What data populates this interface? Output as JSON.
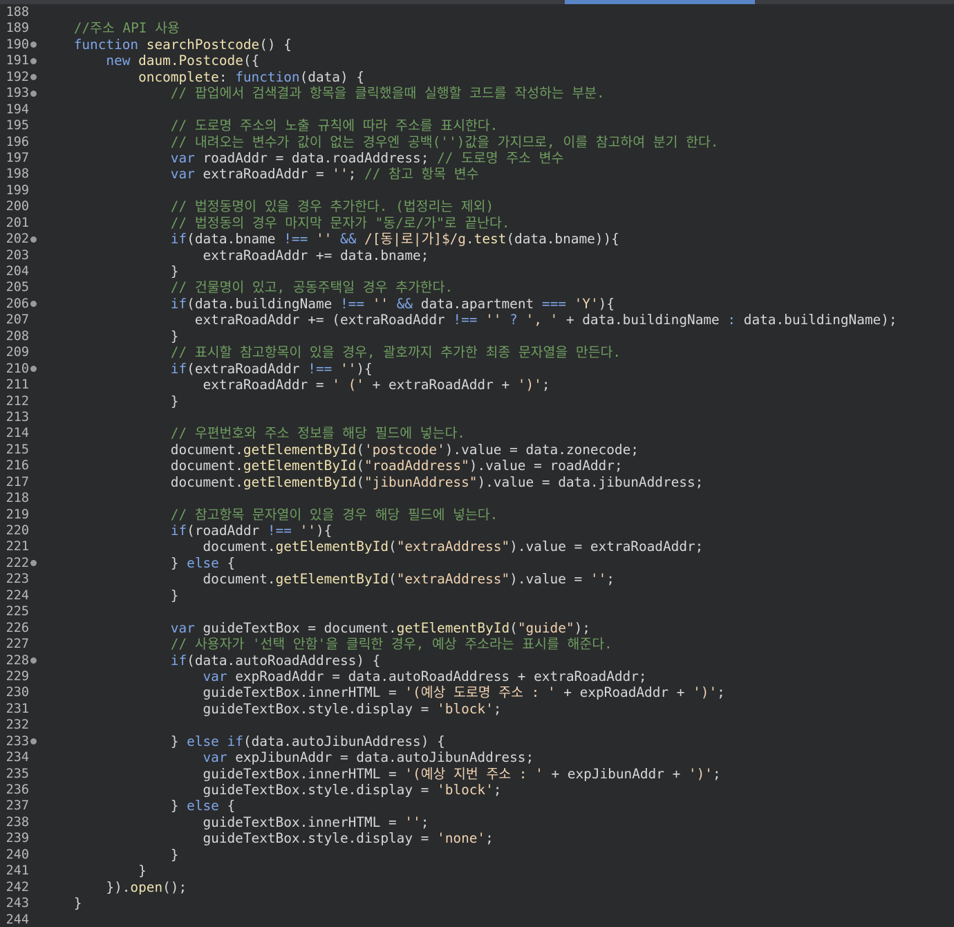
{
  "editor": {
    "language": "javascript",
    "first_line": 188,
    "colors": {
      "background": "#2a2b2d",
      "line_number": "#b9b9b9",
      "keyword": "#7fa6e8",
      "function_name": "#f0e3b0",
      "string": "#f0d3b0",
      "comment": "#6f9e60",
      "text": "#d8d8d8",
      "fold_marker": "#9a9a9a",
      "tab_indicator": "#5a86c8"
    },
    "lines": [
      {
        "n": "188",
        "fold": false,
        "tokens": []
      },
      {
        "n": "189",
        "fold": false,
        "tokens": [
          {
            "t": "    "
          },
          {
            "c": "com",
            "t": "//주소 API 사용"
          }
        ]
      },
      {
        "n": "190",
        "fold": true,
        "tokens": [
          {
            "t": "    "
          },
          {
            "c": "kw",
            "t": "function"
          },
          {
            "t": " "
          },
          {
            "c": "fn",
            "t": "searchPostcode"
          },
          {
            "t": "() {"
          }
        ]
      },
      {
        "n": "191",
        "fold": true,
        "tokens": [
          {
            "t": "        "
          },
          {
            "c": "kw",
            "t": "new"
          },
          {
            "t": " "
          },
          {
            "c": "fn",
            "t": "daum.Postcode"
          },
          {
            "t": "({"
          }
        ]
      },
      {
        "n": "192",
        "fold": true,
        "tokens": [
          {
            "t": "            "
          },
          {
            "c": "fn",
            "t": "oncomplete"
          },
          {
            "t": ": "
          },
          {
            "c": "kw",
            "t": "function"
          },
          {
            "t": "(data) {"
          }
        ]
      },
      {
        "n": "193",
        "fold": true,
        "tokens": [
          {
            "t": "                "
          },
          {
            "c": "com",
            "t": "// 팝업에서 검색결과 항목을 클릭했을때 실행할 코드를 작성하는 부분."
          }
        ]
      },
      {
        "n": "194",
        "fold": false,
        "tokens": []
      },
      {
        "n": "195",
        "fold": false,
        "tokens": [
          {
            "t": "                "
          },
          {
            "c": "com",
            "t": "// 도로명 주소의 노출 규칙에 따라 주소를 표시한다."
          }
        ]
      },
      {
        "n": "196",
        "fold": false,
        "tokens": [
          {
            "t": "                "
          },
          {
            "c": "com",
            "t": "// 내려오는 변수가 값이 없는 경우엔 공백('')값을 가지므로, 이를 참고하여 분기 한다."
          }
        ]
      },
      {
        "n": "197",
        "fold": false,
        "tokens": [
          {
            "t": "                "
          },
          {
            "c": "kw",
            "t": "var"
          },
          {
            "t": " roadAddr = data.roadAddress; "
          },
          {
            "c": "com",
            "t": "// 도로명 주소 변수"
          }
        ]
      },
      {
        "n": "198",
        "fold": false,
        "tokens": [
          {
            "t": "                "
          },
          {
            "c": "kw",
            "t": "var"
          },
          {
            "t": " extraRoadAddr = "
          },
          {
            "c": "str",
            "t": "''"
          },
          {
            "t": "; "
          },
          {
            "c": "com",
            "t": "// 참고 항목 변수"
          }
        ]
      },
      {
        "n": "199",
        "fold": false,
        "tokens": []
      },
      {
        "n": "200",
        "fold": false,
        "tokens": [
          {
            "t": "                "
          },
          {
            "c": "com",
            "t": "// 법정동명이 있을 경우 추가한다. (법정리는 제외)"
          }
        ]
      },
      {
        "n": "201",
        "fold": false,
        "tokens": [
          {
            "t": "                "
          },
          {
            "c": "com",
            "t": "// 법정동의 경우 마지막 문자가 \"동/로/가\"로 끝난다."
          }
        ]
      },
      {
        "n": "202",
        "fold": true,
        "tokens": [
          {
            "t": "                "
          },
          {
            "c": "kw",
            "t": "if"
          },
          {
            "t": "(data.bname "
          },
          {
            "c": "kw",
            "t": "!=="
          },
          {
            "t": " "
          },
          {
            "c": "str",
            "t": "''"
          },
          {
            "t": " "
          },
          {
            "c": "kw",
            "t": "&&"
          },
          {
            "t": " "
          },
          {
            "c": "str",
            "t": "/[동|로|가]$/g"
          },
          {
            "t": "."
          },
          {
            "c": "fn",
            "t": "test"
          },
          {
            "t": "(data.bname)){"
          }
        ]
      },
      {
        "n": "203",
        "fold": false,
        "tokens": [
          {
            "t": "                    extraRoadAddr += data.bname;"
          }
        ]
      },
      {
        "n": "204",
        "fold": false,
        "tokens": [
          {
            "t": "                }"
          }
        ]
      },
      {
        "n": "205",
        "fold": false,
        "tokens": [
          {
            "t": "                "
          },
          {
            "c": "com",
            "t": "// 건물명이 있고, 공동주택일 경우 추가한다."
          }
        ]
      },
      {
        "n": "206",
        "fold": true,
        "tokens": [
          {
            "t": "                "
          },
          {
            "c": "kw",
            "t": "if"
          },
          {
            "t": "(data.buildingName "
          },
          {
            "c": "kw",
            "t": "!=="
          },
          {
            "t": " "
          },
          {
            "c": "str",
            "t": "''"
          },
          {
            "t": " "
          },
          {
            "c": "kw",
            "t": "&&"
          },
          {
            "t": " data.apartment "
          },
          {
            "c": "kw",
            "t": "==="
          },
          {
            "t": " "
          },
          {
            "c": "str",
            "t": "'Y'"
          },
          {
            "t": "){"
          }
        ]
      },
      {
        "n": "207",
        "fold": false,
        "tokens": [
          {
            "t": "                   extraRoadAddr += (extraRoadAddr "
          },
          {
            "c": "kw",
            "t": "!=="
          },
          {
            "t": " "
          },
          {
            "c": "str",
            "t": "''"
          },
          {
            "t": " "
          },
          {
            "c": "kw",
            "t": "?"
          },
          {
            "t": " "
          },
          {
            "c": "str",
            "t": "', '"
          },
          {
            "t": " + data.buildingName "
          },
          {
            "c": "kw",
            "t": ":"
          },
          {
            "t": " data.buildingName);"
          }
        ]
      },
      {
        "n": "208",
        "fold": false,
        "tokens": [
          {
            "t": "                }"
          }
        ]
      },
      {
        "n": "209",
        "fold": false,
        "tokens": [
          {
            "t": "                "
          },
          {
            "c": "com",
            "t": "// 표시할 참고항목이 있을 경우, 괄호까지 추가한 최종 문자열을 만든다."
          }
        ]
      },
      {
        "n": "210",
        "fold": true,
        "tokens": [
          {
            "t": "                "
          },
          {
            "c": "kw",
            "t": "if"
          },
          {
            "t": "(extraRoadAddr "
          },
          {
            "c": "kw",
            "t": "!=="
          },
          {
            "t": " "
          },
          {
            "c": "str",
            "t": "''"
          },
          {
            "t": "){"
          }
        ]
      },
      {
        "n": "211",
        "fold": false,
        "tokens": [
          {
            "t": "                    extraRoadAddr = "
          },
          {
            "c": "str",
            "t": "' ('"
          },
          {
            "t": " + extraRoadAddr + "
          },
          {
            "c": "str",
            "t": "')'"
          },
          {
            "t": ";"
          }
        ]
      },
      {
        "n": "212",
        "fold": false,
        "tokens": [
          {
            "t": "                }"
          }
        ]
      },
      {
        "n": "213",
        "fold": false,
        "tokens": []
      },
      {
        "n": "214",
        "fold": false,
        "tokens": [
          {
            "t": "                "
          },
          {
            "c": "com",
            "t": "// 우편번호와 주소 정보를 해당 필드에 넣는다."
          }
        ]
      },
      {
        "n": "215",
        "fold": false,
        "tokens": [
          {
            "t": "                document."
          },
          {
            "c": "fn",
            "t": "getElementById"
          },
          {
            "t": "("
          },
          {
            "c": "str",
            "t": "'postcode'"
          },
          {
            "t": ").value = data.zonecode;"
          }
        ]
      },
      {
        "n": "216",
        "fold": false,
        "tokens": [
          {
            "t": "                document."
          },
          {
            "c": "fn",
            "t": "getElementById"
          },
          {
            "t": "("
          },
          {
            "c": "str",
            "t": "\"roadAddress\""
          },
          {
            "t": ").value = roadAddr;"
          }
        ]
      },
      {
        "n": "217",
        "fold": false,
        "tokens": [
          {
            "t": "                document."
          },
          {
            "c": "fn",
            "t": "getElementById"
          },
          {
            "t": "("
          },
          {
            "c": "str",
            "t": "\"jibunAddress\""
          },
          {
            "t": ").value = data.jibunAddress;"
          }
        ]
      },
      {
        "n": "218",
        "fold": false,
        "tokens": []
      },
      {
        "n": "219",
        "fold": false,
        "tokens": [
          {
            "t": "                "
          },
          {
            "c": "com",
            "t": "// 참고항목 문자열이 있을 경우 해당 필드에 넣는다."
          }
        ]
      },
      {
        "n": "220",
        "fold": false,
        "tokens": [
          {
            "t": "                "
          },
          {
            "c": "kw",
            "t": "if"
          },
          {
            "t": "(roadAddr "
          },
          {
            "c": "kw",
            "t": "!=="
          },
          {
            "t": " "
          },
          {
            "c": "str",
            "t": "''"
          },
          {
            "t": "){"
          }
        ]
      },
      {
        "n": "221",
        "fold": false,
        "tokens": [
          {
            "t": "                    document."
          },
          {
            "c": "fn",
            "t": "getElementById"
          },
          {
            "t": "("
          },
          {
            "c": "str",
            "t": "\"extraAddress\""
          },
          {
            "t": ").value = extraRoadAddr;"
          }
        ]
      },
      {
        "n": "222",
        "fold": true,
        "tokens": [
          {
            "t": "                } "
          },
          {
            "c": "kw",
            "t": "else"
          },
          {
            "t": " {"
          }
        ]
      },
      {
        "n": "223",
        "fold": false,
        "tokens": [
          {
            "t": "                    document."
          },
          {
            "c": "fn",
            "t": "getElementById"
          },
          {
            "t": "("
          },
          {
            "c": "str",
            "t": "\"extraAddress\""
          },
          {
            "t": ").value = "
          },
          {
            "c": "str",
            "t": "''"
          },
          {
            "t": ";"
          }
        ]
      },
      {
        "n": "224",
        "fold": false,
        "tokens": [
          {
            "t": "                }"
          }
        ]
      },
      {
        "n": "225",
        "fold": false,
        "tokens": []
      },
      {
        "n": "226",
        "fold": false,
        "tokens": [
          {
            "t": "                "
          },
          {
            "c": "kw",
            "t": "var"
          },
          {
            "t": " guideTextBox = document."
          },
          {
            "c": "fn",
            "t": "getElementById"
          },
          {
            "t": "("
          },
          {
            "c": "str",
            "t": "\"guide\""
          },
          {
            "t": ");"
          }
        ]
      },
      {
        "n": "227",
        "fold": false,
        "tokens": [
          {
            "t": "                "
          },
          {
            "c": "com",
            "t": "// 사용자가 '선택 안함'을 클릭한 경우, 예상 주소라는 표시를 해준다."
          }
        ]
      },
      {
        "n": "228",
        "fold": true,
        "tokens": [
          {
            "t": "                "
          },
          {
            "c": "kw",
            "t": "if"
          },
          {
            "t": "(data.autoRoadAddress) {"
          }
        ]
      },
      {
        "n": "229",
        "fold": false,
        "tokens": [
          {
            "t": "                    "
          },
          {
            "c": "kw",
            "t": "var"
          },
          {
            "t": " expRoadAddr = data.autoRoadAddress + extraRoadAddr;"
          }
        ]
      },
      {
        "n": "230",
        "fold": false,
        "tokens": [
          {
            "t": "                    guideTextBox.innerHTML = "
          },
          {
            "c": "str",
            "t": "'(예상 도로명 주소 : '"
          },
          {
            "t": " + expRoadAddr + "
          },
          {
            "c": "str",
            "t": "')'"
          },
          {
            "t": ";"
          }
        ]
      },
      {
        "n": "231",
        "fold": false,
        "tokens": [
          {
            "t": "                    guideTextBox.style.display = "
          },
          {
            "c": "str",
            "t": "'block'"
          },
          {
            "t": ";"
          }
        ]
      },
      {
        "n": "232",
        "fold": false,
        "tokens": []
      },
      {
        "n": "233",
        "fold": true,
        "tokens": [
          {
            "t": "                } "
          },
          {
            "c": "kw",
            "t": "else"
          },
          {
            "t": " "
          },
          {
            "c": "kw",
            "t": "if"
          },
          {
            "t": "(data.autoJibunAddress) {"
          }
        ]
      },
      {
        "n": "234",
        "fold": false,
        "tokens": [
          {
            "t": "                    "
          },
          {
            "c": "kw",
            "t": "var"
          },
          {
            "t": " expJibunAddr = data.autoJibunAddress;"
          }
        ]
      },
      {
        "n": "235",
        "fold": false,
        "tokens": [
          {
            "t": "                    guideTextBox.innerHTML = "
          },
          {
            "c": "str",
            "t": "'(예상 지번 주소 : '"
          },
          {
            "t": " + expJibunAddr + "
          },
          {
            "c": "str",
            "t": "')'"
          },
          {
            "t": ";"
          }
        ]
      },
      {
        "n": "236",
        "fold": false,
        "tokens": [
          {
            "t": "                    guideTextBox.style.display = "
          },
          {
            "c": "str",
            "t": "'block'"
          },
          {
            "t": ";"
          }
        ]
      },
      {
        "n": "237",
        "fold": false,
        "tokens": [
          {
            "t": "                } "
          },
          {
            "c": "kw",
            "t": "else"
          },
          {
            "t": " {"
          }
        ]
      },
      {
        "n": "238",
        "fold": false,
        "tokens": [
          {
            "t": "                    guideTextBox.innerHTML = "
          },
          {
            "c": "str",
            "t": "''"
          },
          {
            "t": ";"
          }
        ]
      },
      {
        "n": "239",
        "fold": false,
        "tokens": [
          {
            "t": "                    guideTextBox.style.display = "
          },
          {
            "c": "str",
            "t": "'none'"
          },
          {
            "t": ";"
          }
        ]
      },
      {
        "n": "240",
        "fold": false,
        "tokens": [
          {
            "t": "                }"
          }
        ]
      },
      {
        "n": "241",
        "fold": false,
        "tokens": [
          {
            "t": "            }"
          }
        ]
      },
      {
        "n": "242",
        "fold": false,
        "tokens": [
          {
            "t": "        })."
          },
          {
            "c": "fn",
            "t": "open"
          },
          {
            "t": "();"
          }
        ]
      },
      {
        "n": "243",
        "fold": false,
        "tokens": [
          {
            "t": "    }"
          }
        ]
      },
      {
        "n": "244",
        "fold": false,
        "tokens": []
      }
    ]
  }
}
